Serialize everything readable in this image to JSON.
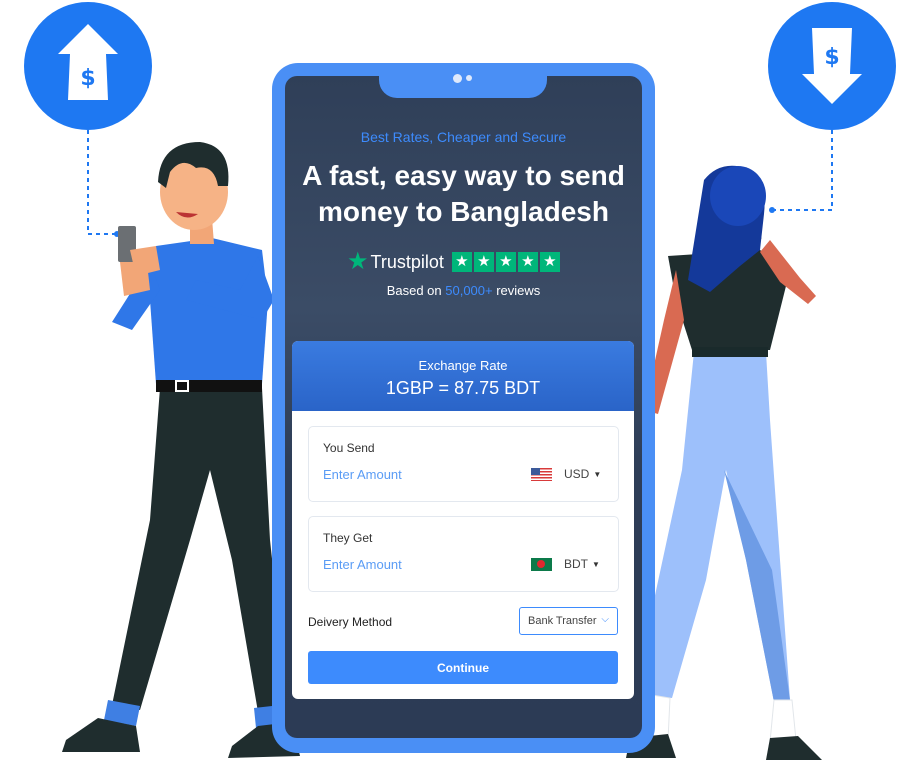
{
  "hero": {
    "tagline": "Best Rates, Cheaper and Secure",
    "title_line1": "A fast, easy way to send",
    "title_line2": "money to Bangladesh",
    "trustpilot": "Trustpilot",
    "reviews_prefix": "Based on ",
    "reviews_count": "50,000+",
    "reviews_suffix": " reviews"
  },
  "exchange": {
    "label": "Exchange Rate",
    "value": "1GBP = 87.75 BDT"
  },
  "send": {
    "label": "You Send",
    "placeholder": "Enter Amount",
    "currency": "USD",
    "flag_icon": "us-flag-icon"
  },
  "get": {
    "label": "They Get",
    "placeholder": "Enter Amount",
    "currency": "BDT",
    "flag_icon": "bd-flag-icon"
  },
  "delivery": {
    "label": "Deivery Method",
    "selected": "Bank Transfer"
  },
  "continue_label": "Continue",
  "icons": {
    "left_badge": "dollar-up-arrow-icon",
    "right_badge": "dollar-down-arrow-icon"
  },
  "colors": {
    "accent": "#3d8bfd",
    "trustpilot_green": "#00b67a",
    "phone_frame": "#4a8ff5"
  }
}
